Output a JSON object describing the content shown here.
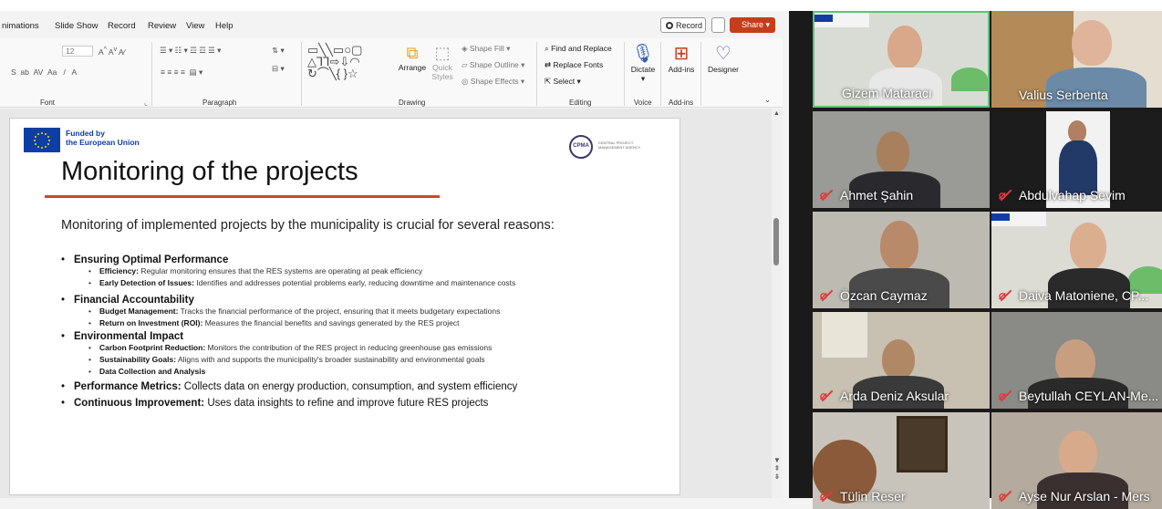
{
  "ribbon": {
    "tabs": [
      "nimations",
      "Slide Show",
      "Record",
      "Review",
      "View",
      "Help"
    ],
    "record_label": "Record",
    "share_label": "Share",
    "font_size": "12",
    "groups": {
      "font": "Font",
      "paragraph": "Paragraph",
      "drawing": "Drawing",
      "editing": "Editing",
      "voice": "Voice",
      "addins": "Add-ins"
    },
    "arrange_label": "Arrange",
    "quick_styles_label": "Quick Styles",
    "shape_fill": "Shape Fill",
    "shape_outline": "Shape Outline",
    "shape_effects": "Shape Effects",
    "find_replace": "Find and Replace",
    "replace_fonts": "Replace Fonts",
    "select": "Select",
    "dictate": "Dictate",
    "addins_btn": "Add-ins",
    "designer": "Designer"
  },
  "slide": {
    "funded_line1": "Funded by",
    "funded_line2": "the European Union",
    "logo_abbr": "CPMA",
    "logo_text": "CENTRAL PROJECT MANAGEMENT AGENCY",
    "title": "Monitoring of the projects",
    "intro": "Monitoring of implemented projects by the municipality is crucial for several reasons:",
    "items": [
      {
        "heading": "Ensuring Optimal Performance",
        "subs": [
          {
            "bold": "Efficiency:",
            "text": " Regular monitoring ensures that the RES systems are operating at peak efficiency"
          },
          {
            "bold": "Early Detection of Issues:",
            "text": " Identifies and addresses potential problems early, reducing downtime and maintenance costs"
          }
        ]
      },
      {
        "heading": "Financial Accountability",
        "subs": [
          {
            "bold": "Budget Management:",
            "text": " Tracks the financial performance of the project, ensuring that it meets budgetary expectations"
          },
          {
            "bold": "Return on Investment (ROI):",
            "text": " Measures the financial benefits and savings generated by the RES project"
          }
        ]
      },
      {
        "heading": "Environmental Impact",
        "subs": [
          {
            "bold": "Carbon Footprint Reduction:",
            "text": " Monitors the contribution of the RES project in reducing greenhouse gas emissions"
          },
          {
            "bold": "Sustainability Goals:",
            "text": " Aligns with and supports the municipality's broader sustainability and environmental goals"
          },
          {
            "bold": "Data Collection and Analysis",
            "text": ""
          }
        ]
      }
    ],
    "extra_items": [
      {
        "bold": "Performance Metrics:",
        "text": " Collects data on energy production, consumption, and system efficiency"
      },
      {
        "bold": "Continuous Improvement:",
        "text": " Uses data insights to refine and improve future RES projects"
      }
    ]
  },
  "participants": [
    {
      "name": "Gizem Mataracı",
      "muted": false
    },
    {
      "name": "Valius Serbenta",
      "muted": false
    },
    {
      "name": "Ahmet Şahin",
      "muted": true
    },
    {
      "name": "Abdulvahap Sevim",
      "muted": true
    },
    {
      "name": "Özcan Caymaz",
      "muted": true
    },
    {
      "name": "Daiva Matoniene, CP...",
      "muted": true
    },
    {
      "name": "Arda Deniz Aksular",
      "muted": true
    },
    {
      "name": "Beytullah CEYLAN-Me...",
      "muted": true
    },
    {
      "name": "Tülin Reser",
      "muted": true
    },
    {
      "name": "Ayse Nur Arslan - Mers",
      "muted": true
    }
  ],
  "colors": {
    "share": "#c43e1c",
    "eu_blue": "#0c3ea6",
    "accent_line": "#c0502a",
    "active_speaker": "#5fc27a",
    "muted_icon": "#e03a3a"
  }
}
